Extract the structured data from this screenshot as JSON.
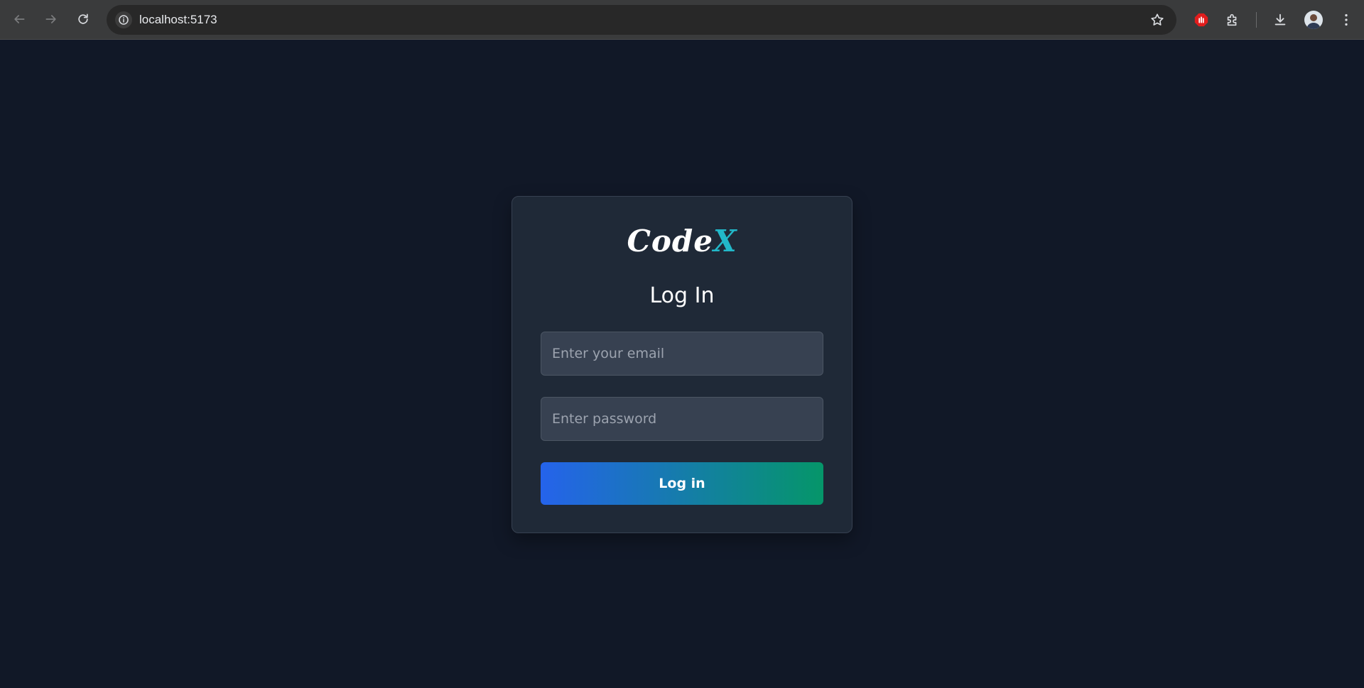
{
  "browser": {
    "url": "localhost:5173",
    "icons": [
      "back-icon",
      "forward-icon",
      "reload-icon",
      "site-info-icon",
      "bookmark-star-icon",
      "adblock-extension-icon",
      "extensions-puzzle-icon",
      "download-icon",
      "profile-avatar"
    ]
  },
  "login": {
    "logo_main": "Code",
    "logo_accent": "X",
    "heading": "Log In",
    "email_placeholder": "Enter your email",
    "email_value": "",
    "password_placeholder": "Enter password",
    "password_value": "",
    "submit_label": "Log in"
  },
  "colors": {
    "page_background": "#111827",
    "card_background": "#1f2937",
    "input_background": "#374151",
    "logo_accent": "#22b8c9",
    "button_gradient_start": "#2563eb",
    "button_gradient_end": "#059669"
  }
}
